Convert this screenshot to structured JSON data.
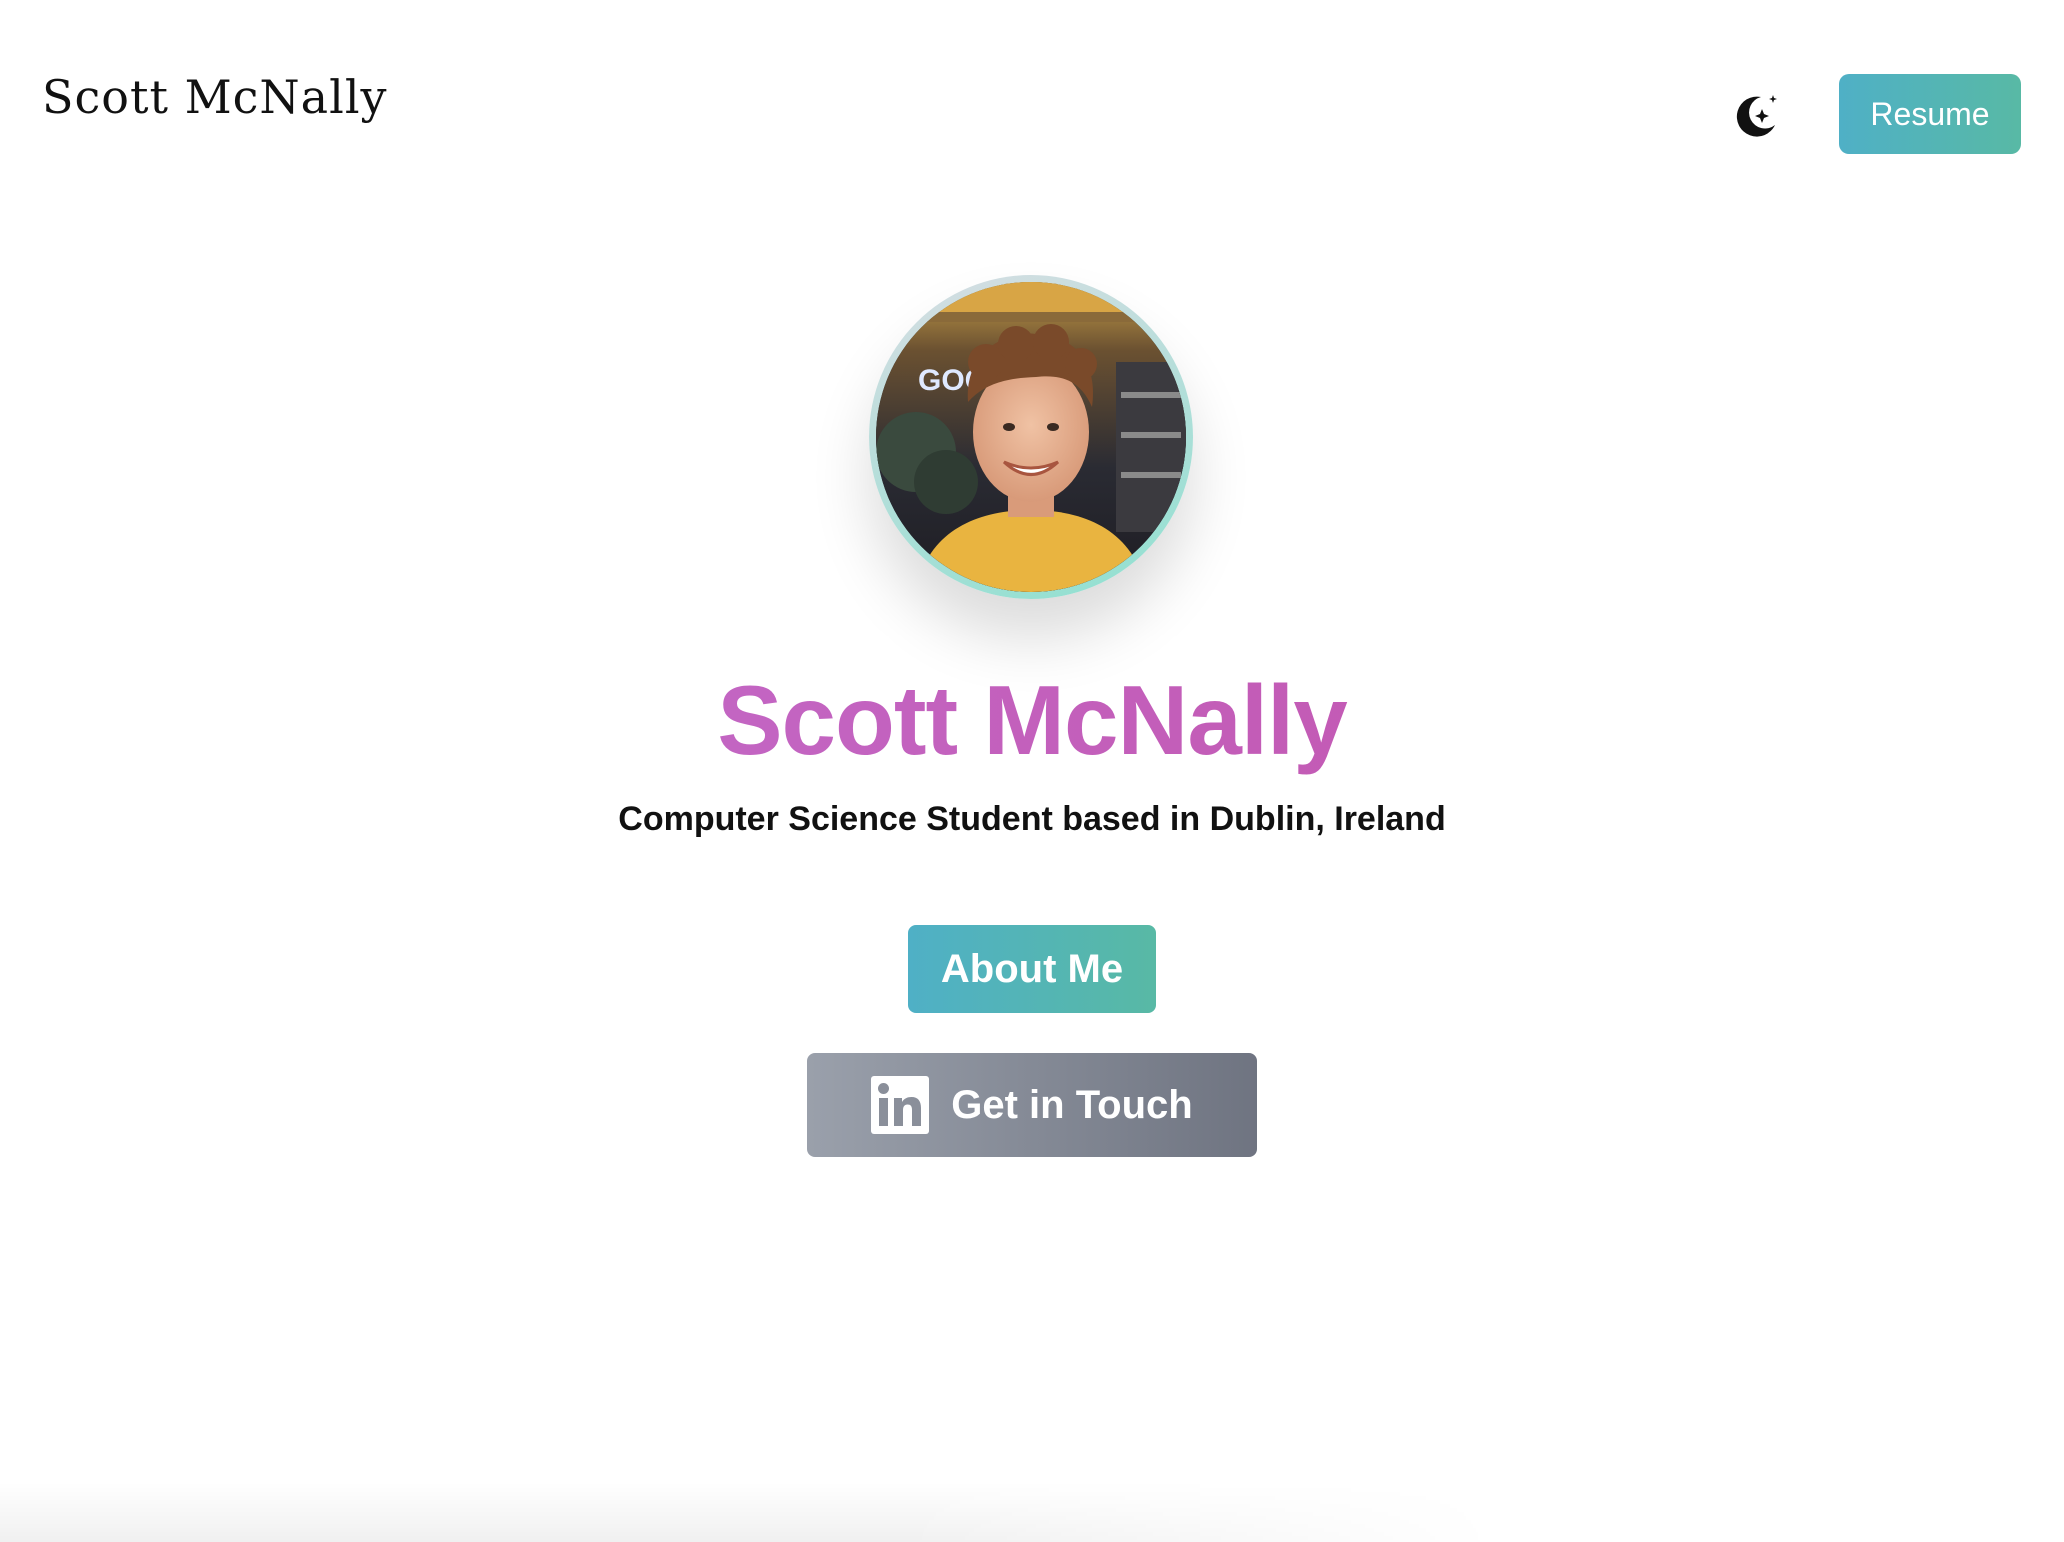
{
  "header": {
    "brand": "Scott McNally",
    "theme_toggle_icon": "moon-stars-icon",
    "resume_label": "Resume"
  },
  "hero": {
    "avatar_icon": "profile-photo",
    "name": "Scott McNally",
    "subtitle": "Computer Science Student based in Dublin, Ireland",
    "about_label": "About Me",
    "contact_label": "Get in Touch",
    "contact_icon": "linkedin-icon"
  },
  "colors": {
    "accent_teal_start": "#4fb0c6",
    "accent_teal_end": "#58b9a5",
    "name_gradient_start": "#c271d2",
    "name_gradient_end": "#c44fa6",
    "contact_gradient_start": "#9aa0ab",
    "contact_gradient_end": "#6f7481"
  }
}
